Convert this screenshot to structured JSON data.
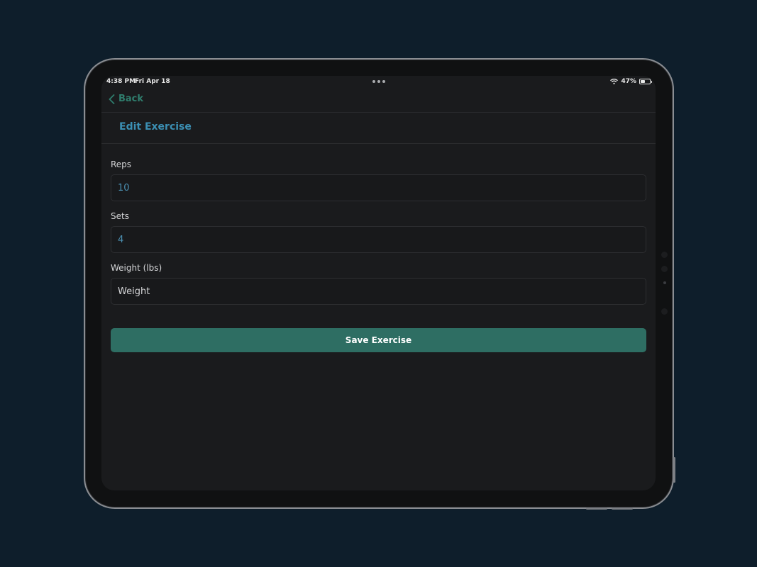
{
  "status_bar": {
    "time": "4:38 PM",
    "date": "Fri Apr 18",
    "battery_percent": "47%",
    "battery_level": 0.47,
    "wifi_icon": "wifi-icon"
  },
  "nav": {
    "back_label": "Back",
    "back_icon": "chevron-left-icon"
  },
  "header": {
    "title": "Edit Exercise"
  },
  "form": {
    "reps": {
      "label": "Reps",
      "value": "10"
    },
    "sets": {
      "label": "Sets",
      "value": "4"
    },
    "weight": {
      "label": "Weight (lbs)",
      "value": "",
      "placeholder": "Weight"
    }
  },
  "actions": {
    "save_label": "Save Exercise"
  },
  "colors": {
    "background": "#0e1e2b",
    "screen": "#1a1b1d",
    "accent_green": "#2e6e63",
    "title_blue": "#3b8fb3",
    "value_blue": "#4b8fb1"
  }
}
